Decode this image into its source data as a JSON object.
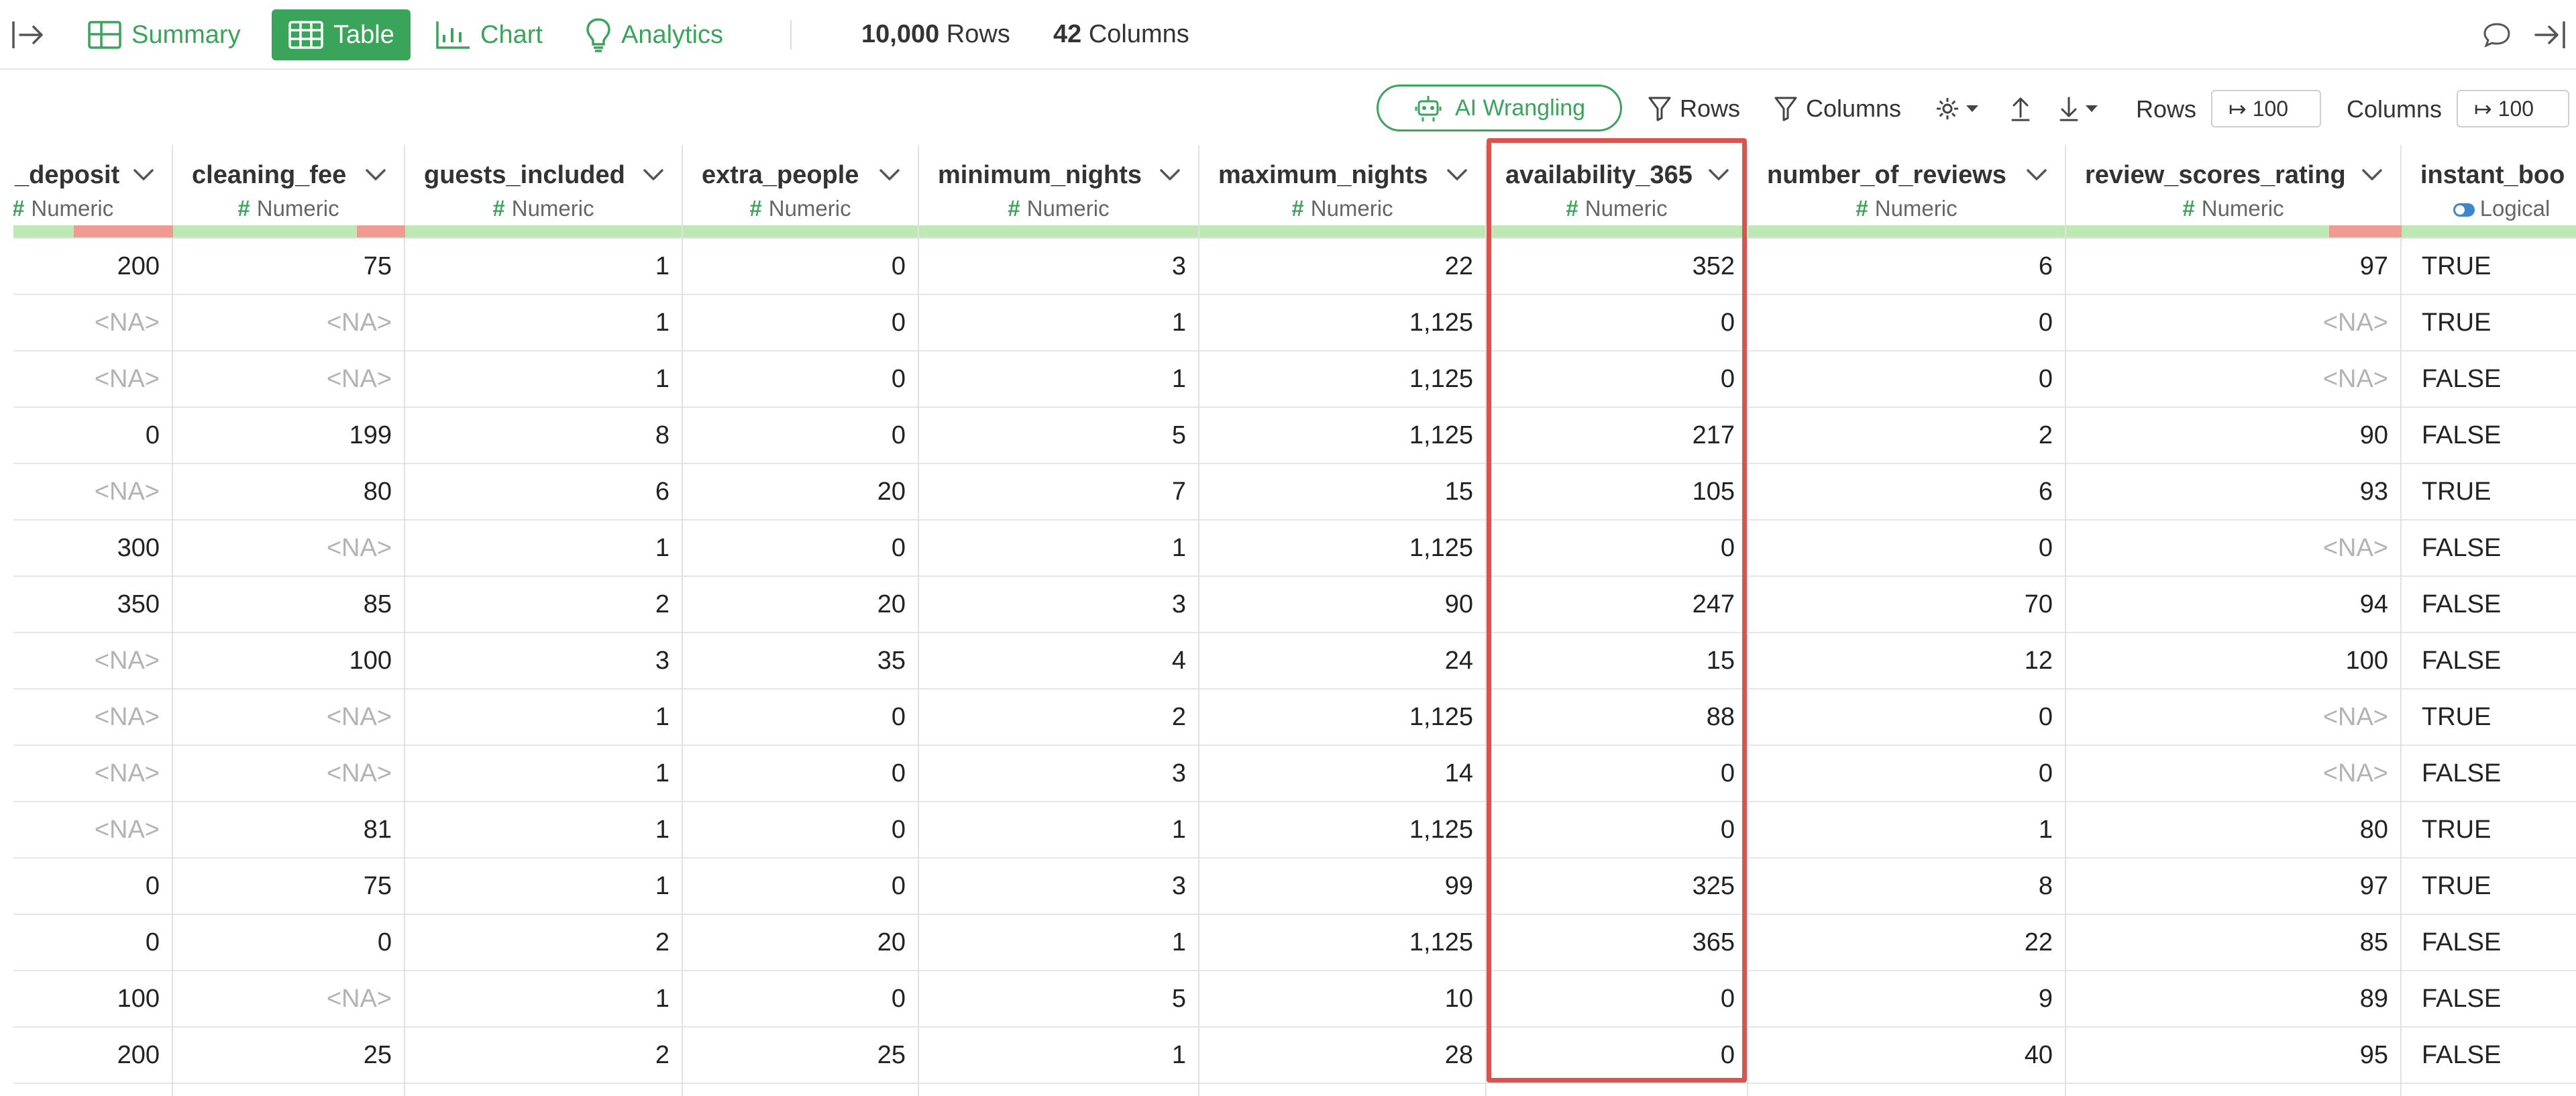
{
  "topbar": {
    "tabs": [
      {
        "label": "Summary",
        "icon": "summary-icon"
      },
      {
        "label": "Table",
        "icon": "table-icon"
      },
      {
        "label": "Chart",
        "icon": "chart-icon"
      },
      {
        "label": "Analytics",
        "icon": "lightbulb-icon"
      }
    ],
    "rows_count": "10,000",
    "rows_label": "Rows",
    "cols_count": "42",
    "cols_label": "Columns"
  },
  "toolbar": {
    "ai_label": "AI Wrangling",
    "rows_filter": "Rows",
    "columns_filter": "Columns",
    "rows_limit_label": "Rows",
    "rows_limit_value": "↦ 100",
    "cols_limit_label": "Columns",
    "cols_limit_value": "↦ 100"
  },
  "colors": {
    "accent": "#3aa45a",
    "quality_ok": "#bfe9b4",
    "quality_missing": "#ef9a92",
    "highlight": "#d9534f",
    "logical_icon": "#3f86c8"
  },
  "columns": [
    {
      "name": "_deposit",
      "type": "Numeric",
      "align": "right",
      "values": [
        "200",
        "<NA>",
        "<NA>",
        "0",
        "<NA>",
        "300",
        "350",
        "<NA>",
        "<NA>",
        "<NA>",
        "<NA>",
        "0",
        "0",
        "100",
        "200"
      ]
    },
    {
      "name": "cleaning_fee",
      "type": "Numeric",
      "align": "right",
      "values": [
        "75",
        "<NA>",
        "<NA>",
        "199",
        "80",
        "<NA>",
        "85",
        "100",
        "<NA>",
        "<NA>",
        "81",
        "75",
        "0",
        "<NA>",
        "25"
      ]
    },
    {
      "name": "guests_included",
      "type": "Numeric",
      "align": "right",
      "values": [
        "1",
        "1",
        "1",
        "8",
        "6",
        "1",
        "2",
        "3",
        "1",
        "1",
        "1",
        "1",
        "2",
        "1",
        "2"
      ]
    },
    {
      "name": "extra_people",
      "type": "Numeric",
      "align": "right",
      "values": [
        "0",
        "0",
        "0",
        "0",
        "20",
        "0",
        "20",
        "35",
        "0",
        "0",
        "0",
        "0",
        "20",
        "0",
        "25"
      ]
    },
    {
      "name": "minimum_nights",
      "type": "Numeric",
      "align": "right",
      "values": [
        "3",
        "1",
        "1",
        "5",
        "7",
        "1",
        "3",
        "4",
        "2",
        "3",
        "1",
        "3",
        "1",
        "5",
        "1"
      ]
    },
    {
      "name": "maximum_nights",
      "type": "Numeric",
      "align": "right",
      "values": [
        "22",
        "1,125",
        "1,125",
        "1,125",
        "15",
        "1,125",
        "90",
        "24",
        "1,125",
        "14",
        "1,125",
        "99",
        "1,125",
        "10",
        "28"
      ]
    },
    {
      "name": "availability_365",
      "type": "Numeric",
      "align": "right",
      "highlighted": true,
      "values": [
        "352",
        "0",
        "0",
        "217",
        "105",
        "0",
        "247",
        "15",
        "88",
        "0",
        "0",
        "325",
        "365",
        "0",
        "0"
      ]
    },
    {
      "name": "number_of_reviews",
      "type": "Numeric",
      "align": "right",
      "values": [
        "6",
        "0",
        "0",
        "2",
        "6",
        "0",
        "70",
        "12",
        "0",
        "0",
        "1",
        "8",
        "22",
        "9",
        "40"
      ]
    },
    {
      "name": "review_scores_rating",
      "type": "Numeric",
      "align": "right",
      "values": [
        "97",
        "<NA>",
        "<NA>",
        "90",
        "93",
        "<NA>",
        "94",
        "100",
        "<NA>",
        "<NA>",
        "80",
        "97",
        "85",
        "89",
        "95"
      ]
    },
    {
      "name": "instant_boo",
      "type": "Logical",
      "align": "left",
      "values": [
        "TRUE",
        "TRUE",
        "FALSE",
        "FALSE",
        "TRUE",
        "FALSE",
        "FALSE",
        "FALSE",
        "TRUE",
        "FALSE",
        "TRUE",
        "TRUE",
        "FALSE",
        "FALSE",
        "FALSE"
      ]
    }
  ]
}
